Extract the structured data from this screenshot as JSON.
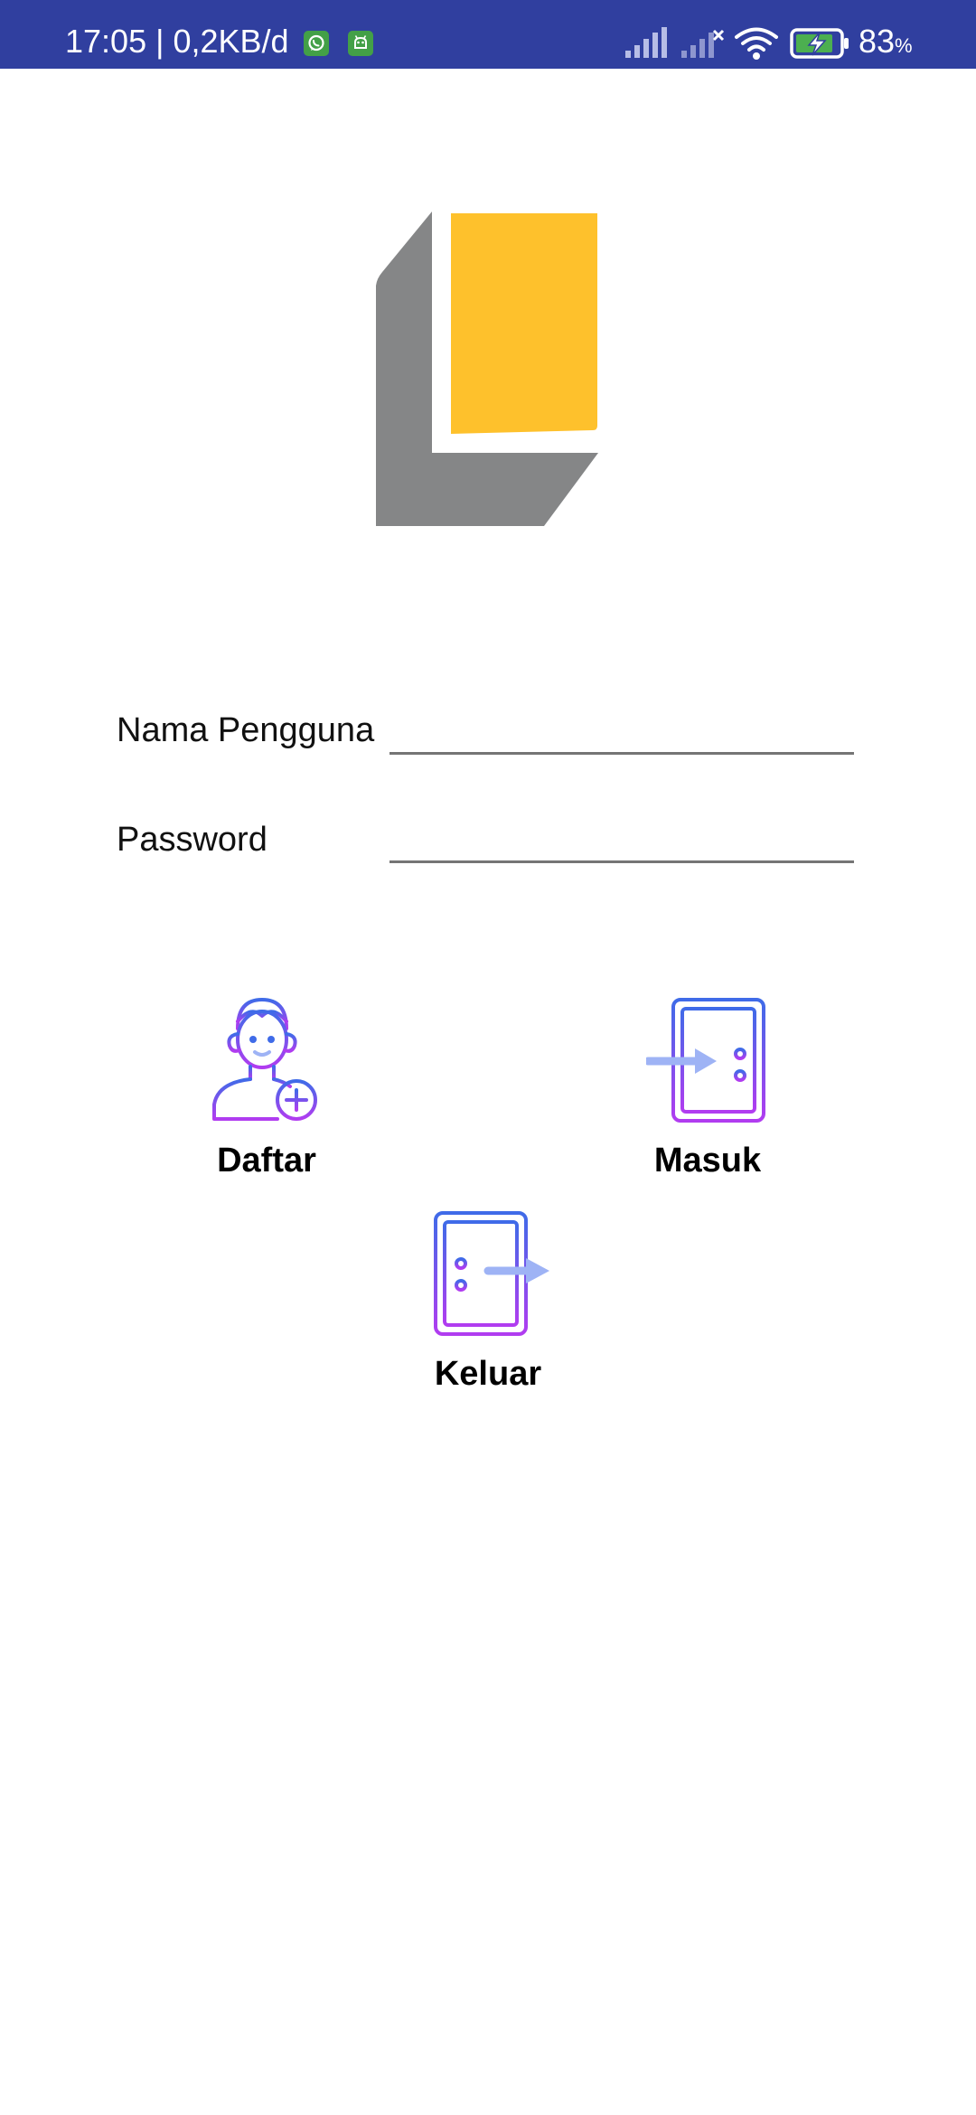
{
  "status_bar": {
    "time": "17:05 | 0,2KB/d",
    "notifications": [
      "whatsapp-icon",
      "android-icon"
    ],
    "indicators": [
      "signal-icon",
      "signal-off-icon",
      "wifi-icon",
      "battery-charging-icon"
    ],
    "battery_percent": "83",
    "battery_unit": "%",
    "background_color": "#303f9f"
  },
  "logo": {
    "icon": "app-logo",
    "colors": {
      "gray": "#858687",
      "yellow": "#fec12c"
    }
  },
  "form": {
    "username_label": "Nama Pengguna",
    "username_value": "",
    "password_label": "Password",
    "password_value": ""
  },
  "actions": {
    "register": {
      "label": "Daftar",
      "icon": "add-user-icon"
    },
    "login": {
      "label": "Masuk",
      "icon": "door-enter-icon"
    },
    "logout": {
      "label": "Keluar",
      "icon": "door-exit-icon"
    }
  },
  "accent_gradient": {
    "start": "#3f6be8",
    "end": "#b13cf0"
  }
}
